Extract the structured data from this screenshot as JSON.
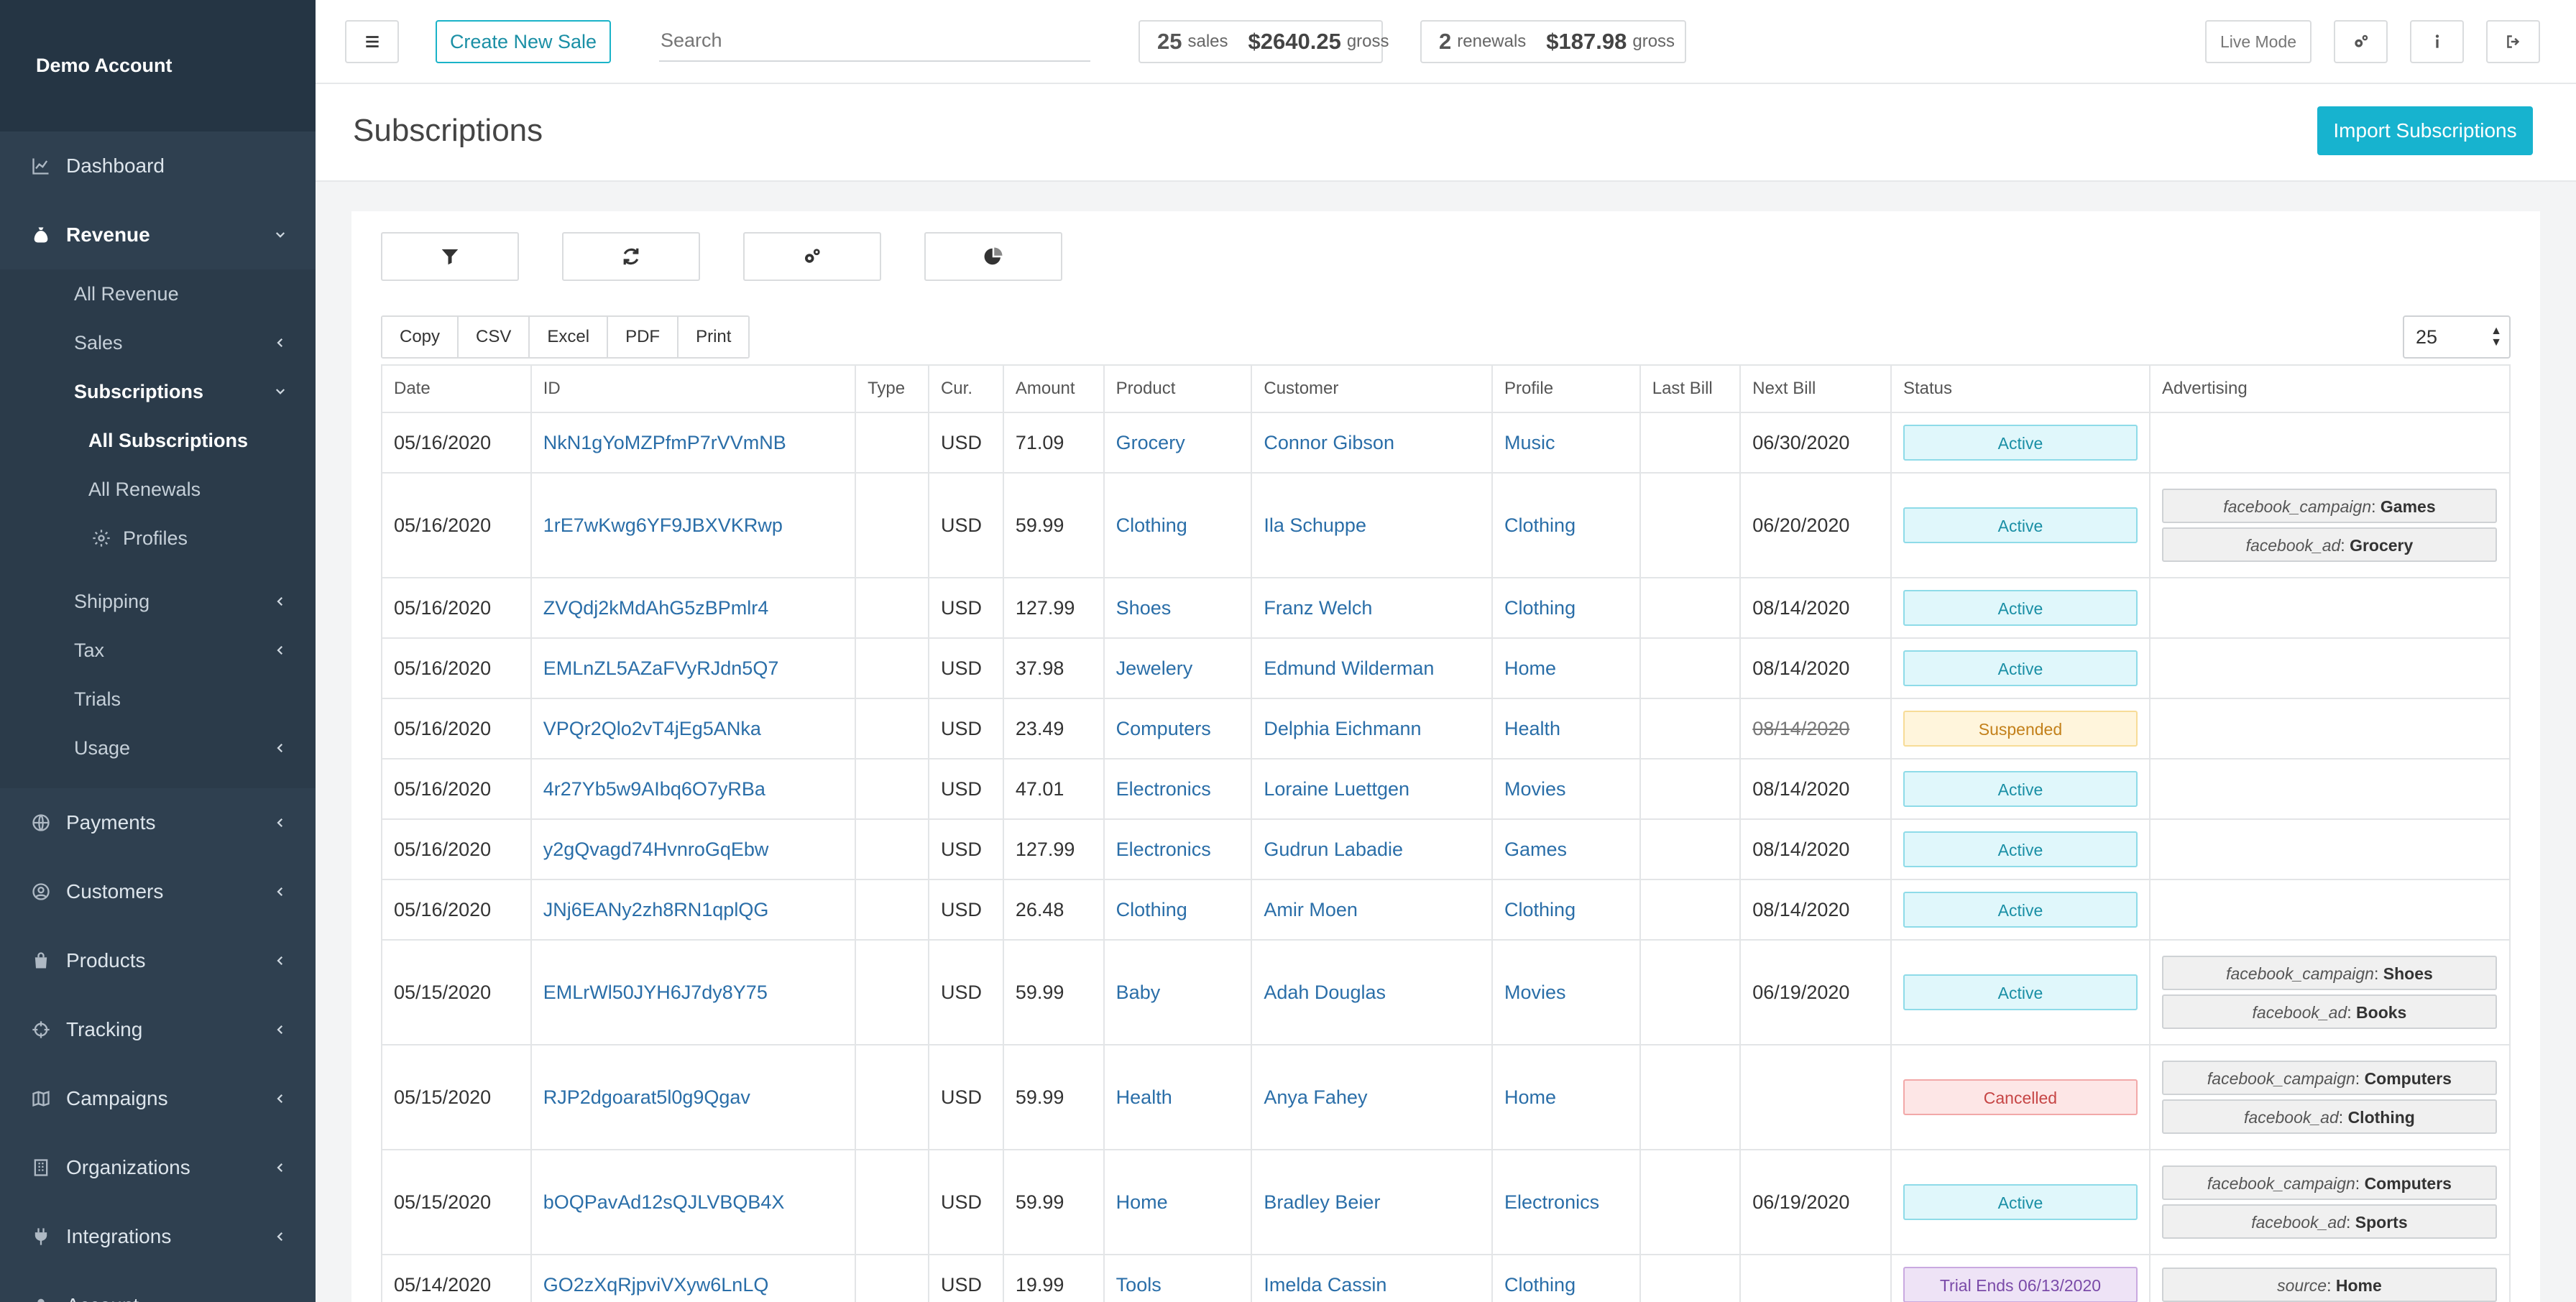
{
  "sidebar": {
    "account": "Demo Account",
    "items": [
      {
        "label": "Dashboard",
        "icon": "chart-line-icon"
      },
      {
        "label": "Revenue",
        "icon": "money-bag-icon"
      },
      {
        "label": "Payments",
        "icon": "globe-icon"
      },
      {
        "label": "Customers",
        "icon": "user-circle-icon"
      },
      {
        "label": "Products",
        "icon": "shopping-bag-icon"
      },
      {
        "label": "Tracking",
        "icon": "crosshairs-icon"
      },
      {
        "label": "Campaigns",
        "icon": "map-icon"
      },
      {
        "label": "Organizations",
        "icon": "building-icon"
      },
      {
        "label": "Integrations",
        "icon": "plug-icon"
      },
      {
        "label": "Account",
        "icon": "user-icon"
      }
    ],
    "revenue_sub": [
      "All Revenue",
      "Sales",
      "Subscriptions",
      "Shipping",
      "Tax",
      "Trials",
      "Usage"
    ],
    "subscriptions_sub": [
      "All Subscriptions",
      "All Renewals",
      "Profiles"
    ]
  },
  "topbar": {
    "create_sale": "Create New Sale",
    "search_placeholder": "Search",
    "sales_count": "25",
    "sales_label": "sales",
    "sales_gross": "$2640.25",
    "renewals_count": "2",
    "renewals_label": "renewals",
    "renewals_gross": "$187.98",
    "gross_label": "gross",
    "live_mode": "Live Mode"
  },
  "page": {
    "title": "Subscriptions",
    "import_button": "Import Subscriptions"
  },
  "export_buttons": [
    "Copy",
    "CSV",
    "Excel",
    "PDF",
    "Print"
  ],
  "page_size": "25",
  "columns": [
    "Date",
    "ID",
    "Type",
    "Cur.",
    "Amount",
    "Product",
    "Customer",
    "Profile",
    "Last Bill",
    "Next Bill",
    "Status",
    "Advertising"
  ],
  "rows": [
    {
      "date": "05/16/2020",
      "id": "NkN1gYoMZPfmP7rVVmNB",
      "type": "",
      "cur": "USD",
      "amount": "71.09",
      "product": "Grocery",
      "customer": "Connor Gibson",
      "profile": "Music",
      "last_bill": "",
      "next_bill": "06/30/2020",
      "status": "Active",
      "ads": []
    },
    {
      "date": "05/16/2020",
      "id": "1rE7wKwg6YF9JBXVKRwp",
      "type": "",
      "cur": "USD",
      "amount": "59.99",
      "product": "Clothing",
      "customer": "Ila Schuppe",
      "profile": "Clothing",
      "last_bill": "",
      "next_bill": "06/20/2020",
      "status": "Active",
      "ads": [
        {
          "k": "facebook_campaign",
          "v": "Games"
        },
        {
          "k": "facebook_ad",
          "v": "Grocery"
        }
      ]
    },
    {
      "date": "05/16/2020",
      "id": "ZVQdj2kMdAhG5zBPmlr4",
      "type": "",
      "cur": "USD",
      "amount": "127.99",
      "product": "Shoes",
      "customer": "Franz Welch",
      "profile": "Clothing",
      "last_bill": "",
      "next_bill": "08/14/2020",
      "status": "Active",
      "ads": []
    },
    {
      "date": "05/16/2020",
      "id": "EMLnZL5AZaFVyRJdn5Q7",
      "type": "",
      "cur": "USD",
      "amount": "37.98",
      "product": "Jewelery",
      "customer": "Edmund Wilderman",
      "profile": "Home",
      "last_bill": "",
      "next_bill": "08/14/2020",
      "status": "Active",
      "ads": []
    },
    {
      "date": "05/16/2020",
      "id": "VPQr2Qlo2vT4jEg5ANka",
      "type": "",
      "cur": "USD",
      "amount": "23.49",
      "product": "Computers",
      "customer": "Delphia Eichmann",
      "profile": "Health",
      "last_bill": "",
      "next_bill": "08/14/2020",
      "status": "Suspended",
      "ads": []
    },
    {
      "date": "05/16/2020",
      "id": "4r27Yb5w9AIbq6O7yRBa",
      "type": "",
      "cur": "USD",
      "amount": "47.01",
      "product": "Electronics",
      "customer": "Loraine Luettgen",
      "profile": "Movies",
      "last_bill": "",
      "next_bill": "08/14/2020",
      "status": "Active",
      "ads": []
    },
    {
      "date": "05/16/2020",
      "id": "y2gQvagd74HvnroGqEbw",
      "type": "",
      "cur": "USD",
      "amount": "127.99",
      "product": "Electronics",
      "customer": "Gudrun Labadie",
      "profile": "Games",
      "last_bill": "",
      "next_bill": "08/14/2020",
      "status": "Active",
      "ads": []
    },
    {
      "date": "05/16/2020",
      "id": "JNj6EANy2zh8RN1qplQG",
      "type": "",
      "cur": "USD",
      "amount": "26.48",
      "product": "Clothing",
      "customer": "Amir Moen",
      "profile": "Clothing",
      "last_bill": "",
      "next_bill": "08/14/2020",
      "status": "Active",
      "ads": []
    },
    {
      "date": "05/15/2020",
      "id": "EMLrWl50JYH6J7dy8Y75",
      "type": "",
      "cur": "USD",
      "amount": "59.99",
      "product": "Baby",
      "customer": "Adah Douglas",
      "profile": "Movies",
      "last_bill": "",
      "next_bill": "06/19/2020",
      "status": "Active",
      "ads": [
        {
          "k": "facebook_campaign",
          "v": "Shoes"
        },
        {
          "k": "facebook_ad",
          "v": "Books"
        }
      ]
    },
    {
      "date": "05/15/2020",
      "id": "RJP2dgoarat5l0g9Qgav",
      "type": "",
      "cur": "USD",
      "amount": "59.99",
      "product": "Health",
      "customer": "Anya Fahey",
      "profile": "Home",
      "last_bill": "",
      "next_bill": "",
      "status": "Cancelled",
      "ads": [
        {
          "k": "facebook_campaign",
          "v": "Computers"
        },
        {
          "k": "facebook_ad",
          "v": "Clothing"
        }
      ]
    },
    {
      "date": "05/15/2020",
      "id": "bOQPavAd12sQJLVBQB4X",
      "type": "",
      "cur": "USD",
      "amount": "59.99",
      "product": "Home",
      "customer": "Bradley Beier",
      "profile": "Electronics",
      "last_bill": "",
      "next_bill": "06/19/2020",
      "status": "Active",
      "ads": [
        {
          "k": "facebook_campaign",
          "v": "Computers"
        },
        {
          "k": "facebook_ad",
          "v": "Sports"
        }
      ]
    },
    {
      "date": "05/14/2020",
      "id": "GO2zXqRjpviVXyw6LnLQ",
      "type": "",
      "cur": "USD",
      "amount": "19.99",
      "product": "Tools",
      "customer": "Imelda Cassin",
      "profile": "Clothing",
      "last_bill": "",
      "next_bill": "",
      "status": "Trial Ends 06/13/2020",
      "ads": [
        {
          "k": "source",
          "v": "Home"
        }
      ]
    }
  ],
  "colors": {
    "sidebar_bg": "#2f4050",
    "accent": "#17b3cf",
    "link": "#2a6ea8"
  }
}
